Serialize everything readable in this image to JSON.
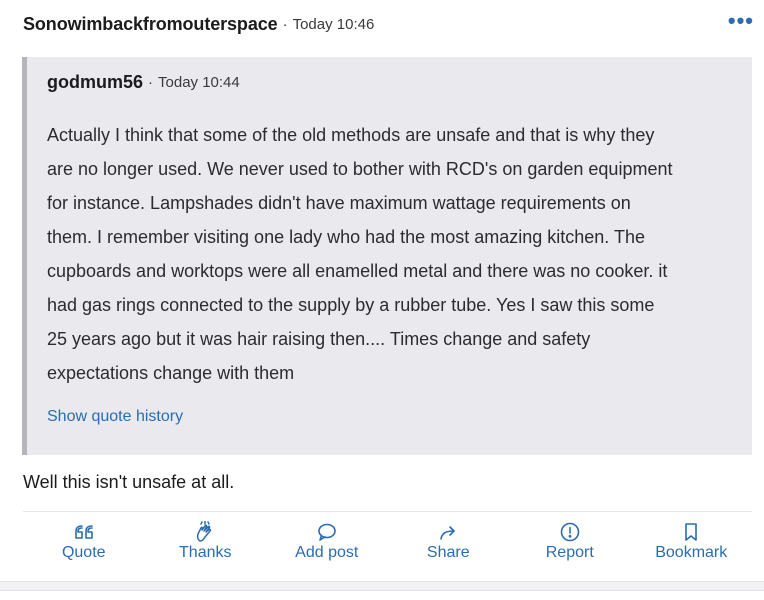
{
  "post": {
    "author": "Sonowimbackfromouterspace",
    "separator": "·",
    "time": "Today 10:46",
    "more_icon": "more-dots-icon",
    "more_label": "•••",
    "quote": {
      "author": "godmum56",
      "separator": "·",
      "time": "Today 10:44",
      "lines": [
        "Actually I think that some of the old methods are unsafe and that is why they",
        "are no longer used. We never used to bother with RCD's on garden equipment",
        "for instance. Lampshades didn't have maximum wattage requirements on",
        "them. I remember visiting one lady who had the most amazing kitchen. The",
        "cupboards and worktops were all enamelled metal and there was no cooker. it",
        "had gas rings connected to the supply by a rubber tube. Yes I saw this some",
        "25 years ago but it was hair raising then.... Times change and safety",
        "expectations change with them"
      ],
      "history_link": "Show quote history"
    },
    "reply": "Well this isn't unsafe at all.",
    "actions": {
      "quote": {
        "label": "Quote",
        "icon": "quote-icon"
      },
      "thanks": {
        "label": "Thanks",
        "icon": "clap-icon"
      },
      "add_post": {
        "label": "Add post",
        "icon": "speech-bubble-icon"
      },
      "share": {
        "label": "Share",
        "icon": "share-arrow-icon"
      },
      "report": {
        "label": "Report",
        "icon": "report-icon"
      },
      "bookmark": {
        "label": "Bookmark",
        "icon": "bookmark-icon"
      }
    },
    "colors": {
      "accent": "#2b6cb0",
      "quote_bg": "#e9e9ee",
      "quote_border": "#b5b5bb"
    }
  }
}
